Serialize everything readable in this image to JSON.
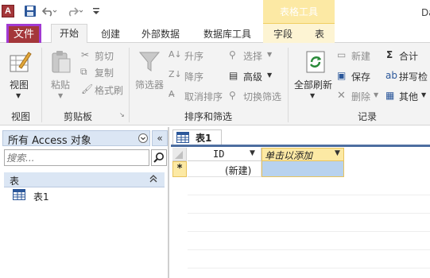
{
  "titlebar": {
    "app_icon": "A",
    "title_partial": "Da",
    "context_group": "表格工具"
  },
  "tabs": {
    "file": "文件",
    "home": "开始",
    "create": "创建",
    "external": "外部数据",
    "dbtools": "数据库工具",
    "fields": "字段",
    "table": "表"
  },
  "ribbon": {
    "views": {
      "view": "视图",
      "label": "视图"
    },
    "clipboard": {
      "paste": "粘贴",
      "cut": "剪切",
      "copy": "复制",
      "format_painter": "格式刷",
      "label": "剪贴板"
    },
    "sort_filter": {
      "filter": "筛选器",
      "ascending": "升序",
      "descending": "降序",
      "remove_sort": "取消排序",
      "selection": "选择",
      "advanced": "高级",
      "toggle_filter": "切换筛选",
      "label": "排序和筛选"
    },
    "records": {
      "refresh_all": "全部刷新",
      "new": "新建",
      "save": "保存",
      "delete": "删除",
      "totals": "合计",
      "spelling": "拼写检",
      "more": "其他",
      "label": "记录"
    }
  },
  "nav": {
    "title": "所有 Access 对象",
    "collapse": "«",
    "search_placeholder": "搜索...",
    "group": "表",
    "items": [
      {
        "label": "表1"
      }
    ]
  },
  "document": {
    "tab_label": "表1",
    "columns": [
      {
        "label": "ID"
      },
      {
        "label": "单击以添加"
      }
    ],
    "new_row_marker": "*",
    "new_row_value": "(新建)"
  },
  "colors": {
    "file_tab": "#a4373a",
    "highlight_outline": "#a23ad2",
    "context_yellow": "#fce9a4",
    "selected_cell": "#b8d2ee",
    "nav_header": "#dbe6f4"
  }
}
